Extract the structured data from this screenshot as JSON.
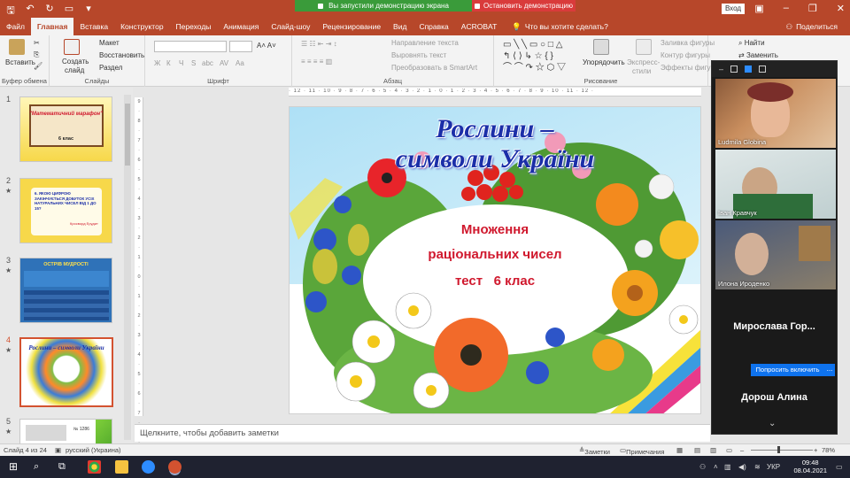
{
  "titlebar": {
    "share_notice": "Вы запустили демонстрацию экрана",
    "stop_share": "Остановить демонстрацию",
    "login": "Вход"
  },
  "menu": {
    "tabs": [
      "Файл",
      "Главная",
      "Вставка",
      "Конструктор",
      "Переходы",
      "Анимация",
      "Слайд-шоу",
      "Рецензирование",
      "Вид",
      "Справка",
      "ACROBAT"
    ],
    "active_tab": "Главная",
    "tell_me": "Что вы хотите сделать?",
    "share": "Поделиться"
  },
  "ribbon": {
    "paste": "Вставить",
    "clipboard": "Буфер обмена",
    "new_slide_1": "Создать",
    "new_slide_2": "слайд",
    "layout": "Макет",
    "reset": "Восстановить",
    "section": "Раздел",
    "slides_group": "Слайды",
    "font_group": "Шрифт",
    "paragraph_group": "Абзац",
    "text_direction": "Направление текста",
    "align_text": "Выровнять текст",
    "smartart": "Преобразовать в SmartArt",
    "drawing_group": "Рисование",
    "arrange": "Упорядочить",
    "express_1": "Экспресс-",
    "express_2": "стили",
    "shape_fill": "Заливка фигуры",
    "shape_outline": "Контур фигуры",
    "shape_effects": "Эффекты фигур",
    "find": "Найти",
    "replace": "Заменить",
    "font_format_icons": [
      "Ж",
      "К",
      "Ч",
      "S",
      "abc",
      "AV",
      "Aa"
    ]
  },
  "slides": [
    {
      "num": "1",
      "title": "\"Математичний марафон\"",
      "subtitle": "6 клас",
      "star": false
    },
    {
      "num": "2",
      "text": "6. ЯКОЮ ЦИФРОЮ ЗАКІНЧУЄТЬСЯ ДОБУТОК УСІХ НАТУРАЛЬНИХ ЧИСЕЛ ВІД 1 ДО 15?",
      "caption": "Кросворд Ерудит",
      "star": true
    },
    {
      "num": "3",
      "title": "ОСТРІВ МУДРОСТІ",
      "star": true
    },
    {
      "num": "4",
      "title": "Рослини – символи України",
      "star": true,
      "selected": true
    },
    {
      "num": "5",
      "text": "№ 1286",
      "star": true
    }
  ],
  "main_slide": {
    "title_line1": "Рослини –",
    "title_line2": "символи України",
    "line1": "Множення",
    "line2": "раціональних чисел",
    "line3": "тест   6 клас"
  },
  "notes_placeholder": "Щелкните, чтобы добавить заметки",
  "status": {
    "slide_info": "Слайд 4 из 24",
    "language": "русский (Украина)",
    "notes": "Заметки",
    "comments": "Примечания",
    "zoom": "78%"
  },
  "zoom_panel": {
    "participants": [
      {
        "name": "Ludmila Globina",
        "type": "video"
      },
      {
        "name": "Іван Кравчук",
        "type": "video"
      },
      {
        "name": "Илона Ироденко",
        "type": "video"
      },
      {
        "name": "Мирослава  Гор...",
        "type": "name"
      },
      {
        "name": "Дорош Алина",
        "type": "name"
      }
    ],
    "ask_enable": "Попросить включить",
    "more": "..."
  },
  "taskbar": {
    "time": "09:48",
    "date": "08.04.2021",
    "lang": "УКР"
  },
  "colors": {
    "ppt_accent": "#b7472a",
    "zoom_blue": "#0e72ed",
    "title_blue": "#1b2ea8",
    "subtitle_red": "#d0182d"
  }
}
